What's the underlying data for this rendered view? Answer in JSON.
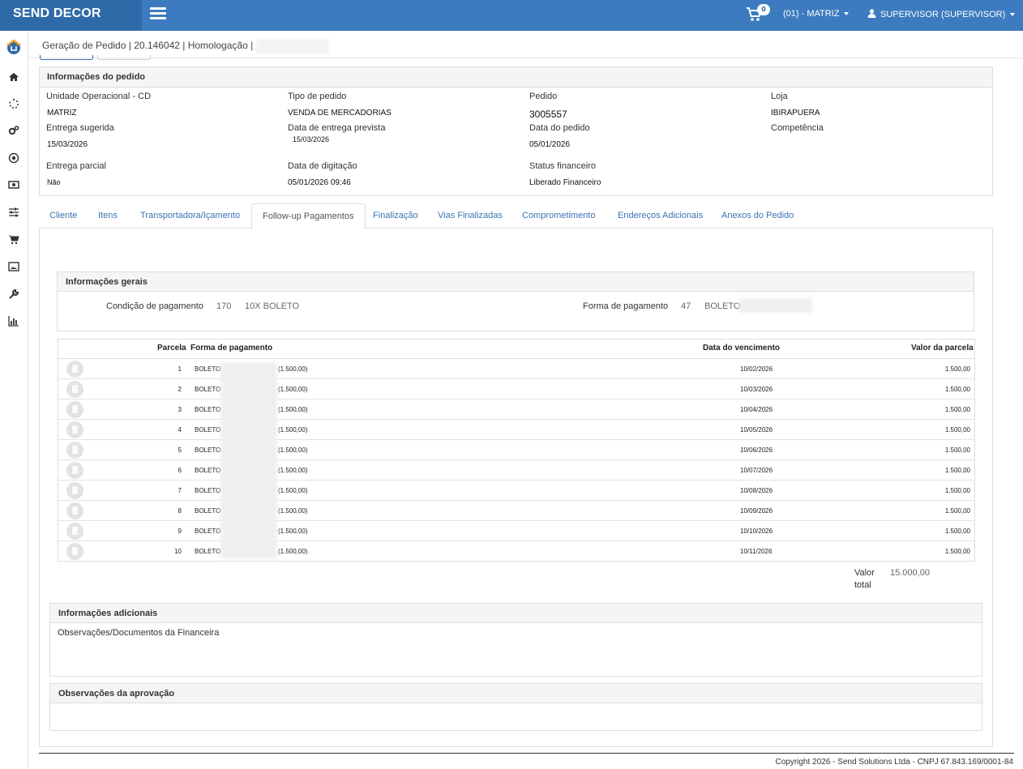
{
  "app": {
    "brand": "SEND DECOR",
    "cart_count": "0",
    "store": "(01) - MATRIZ",
    "user": "SUPERVISOR (SUPERVISOR)"
  },
  "breadcrumb": "Geração de Pedido | 20.146042 | Homologação |",
  "order_info": {
    "title": "Informações do pedido",
    "fields": [
      {
        "label": "Unidade Operacional - CD",
        "value": "MATRIZ"
      },
      {
        "label": "Tipo de pedido",
        "value": "VENDA DE MERCADORIAS"
      },
      {
        "label": "Pedido",
        "value": "3005557"
      },
      {
        "label": "Loja",
        "value": "IBIRAPUERA"
      },
      {
        "label": "Entrega sugerida",
        "value": "15/03/2026"
      },
      {
        "label": "Data de entrega prevista",
        "value": "15/03/2026"
      },
      {
        "label": "Data do pedido",
        "value": "05/01/2026"
      },
      {
        "label": "Competência",
        "value": ""
      },
      {
        "label": "Entrega parcial",
        "value": "Não"
      },
      {
        "label": "Data de digitação",
        "value": "05/01/2026 09:46"
      },
      {
        "label": "Status financeiro",
        "value": "Liberado Financeiro"
      }
    ]
  },
  "tabs": [
    "Cliente",
    "Itens",
    "Transportadora/Içamento",
    "Follow-up Pagamentos",
    "Finalização",
    "Vias Finalizadas",
    "Comprometimento",
    "Endereços Adicionais",
    "Anexos do Pedido"
  ],
  "active_tab": "Follow-up Pagamentos",
  "general": {
    "title": "Informações gerais",
    "payment_condition_label": "Condição de pagamento",
    "payment_condition_code": "170",
    "payment_condition_desc": "10X BOLETO",
    "payment_form_label": "Forma de pagamento",
    "payment_form_code": "47",
    "payment_form_desc": "BOLETO"
  },
  "installments": {
    "headers": {
      "parcela": "Parcela",
      "forma": "Forma de pagamento",
      "vencimento": "Data do vencimento",
      "valor": "Valor da parcela"
    },
    "rows": [
      {
        "n": "1",
        "forma": "BOLETO",
        "amount": "(1.500,00)",
        "due": "10/02/2026",
        "value": "1.500,00"
      },
      {
        "n": "2",
        "forma": "BOLETO",
        "amount": "(1.500,00)",
        "due": "10/03/2026",
        "value": "1.500,00"
      },
      {
        "n": "3",
        "forma": "BOLETO",
        "amount": "(1.500,00)",
        "due": "10/04/2026",
        "value": "1.500,00"
      },
      {
        "n": "4",
        "forma": "BOLETO",
        "amount": "(1.500,00)",
        "due": "10/05/2026",
        "value": "1.500,00"
      },
      {
        "n": "5",
        "forma": "BOLETO",
        "amount": "(1.500,00)",
        "due": "10/06/2026",
        "value": "1.500,00"
      },
      {
        "n": "6",
        "forma": "BOLETO",
        "amount": "(1.500,00)",
        "due": "10/07/2026",
        "value": "1.500,00"
      },
      {
        "n": "7",
        "forma": "BOLETO",
        "amount": "(1.500,00)",
        "due": "10/08/2026",
        "value": "1.500,00"
      },
      {
        "n": "8",
        "forma": "BOLETO",
        "amount": "(1.500,00)",
        "due": "10/09/2026",
        "value": "1.500,00"
      },
      {
        "n": "9",
        "forma": "BOLETO",
        "amount": "(1.500,00)",
        "due": "10/10/2026",
        "value": "1.500,00"
      },
      {
        "n": "10",
        "forma": "BOLETO",
        "amount": "(1.500,00)",
        "due": "10/11/2026",
        "value": "1.500,00"
      }
    ],
    "total_label_1": "Valor",
    "total_label_2": "total",
    "total_value": "15.000,00"
  },
  "additional": {
    "title": "Informações adicionais",
    "text": "Observações/Documentos da Financeira"
  },
  "approval": {
    "title": "Observações da aprovação"
  },
  "footer": "Copyright 2026 - Send Solutions Ltda - CNPJ 67.843.169/0001-84",
  "colors": {
    "topbar": "#3c7bbf",
    "brand_bg": "#2f6aa8",
    "link": "#3a73b2"
  },
  "sidebar_icons": [
    "home-icon",
    "spinner-icon",
    "cogs-icon",
    "target-icon",
    "money-icon",
    "sliders-icon",
    "cart-icon",
    "image-icon",
    "wrench-icon",
    "bar-chart-icon"
  ]
}
